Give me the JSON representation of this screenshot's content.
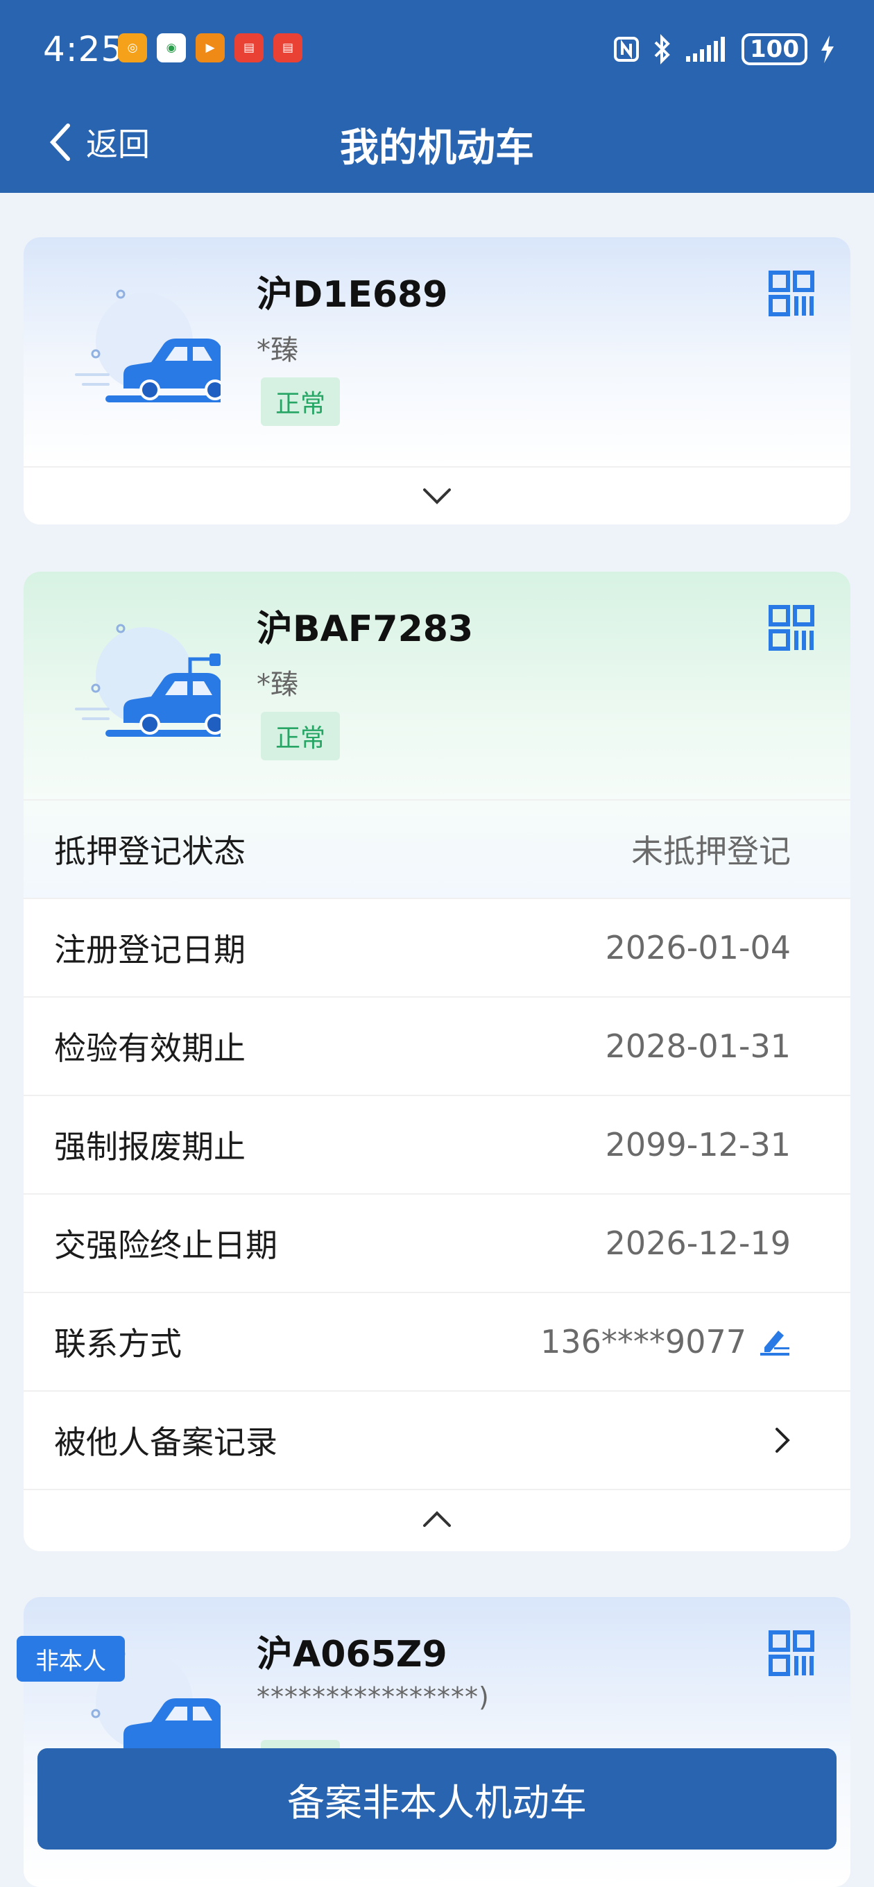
{
  "status_bar": {
    "time": "4:25",
    "battery": "100"
  },
  "nav": {
    "back_label": "返回",
    "title": "我的机动车"
  },
  "vehicles": [
    {
      "plate": "沪D1E689",
      "owner": "*臻",
      "status": "正常",
      "type": "fuel",
      "expanded": false
    },
    {
      "plate": "沪BAF7283",
      "owner": "*臻",
      "status": "正常",
      "type": "electric",
      "expanded": true,
      "details": [
        {
          "label": "抵押登记状态",
          "value": "未抵押登记"
        },
        {
          "label": "注册登记日期",
          "value": "2026-01-04"
        },
        {
          "label": "检验有效期止",
          "value": "2028-01-31"
        },
        {
          "label": "强制报废期止",
          "value": "2099-12-31"
        },
        {
          "label": "交强险终止日期",
          "value": "2026-12-19"
        },
        {
          "label": "联系方式",
          "value": "136****9077"
        },
        {
          "label": "被他人备案记录",
          "value": ""
        }
      ]
    },
    {
      "plate": "沪A065Z9",
      "owner": "****************)",
      "tag": "非本人",
      "type": "fuel"
    }
  ],
  "bottom_button": "备案非本人机动车",
  "colors": {
    "primary": "#2864b0",
    "accent": "#2a7ae6",
    "status_green": "#26a565"
  }
}
